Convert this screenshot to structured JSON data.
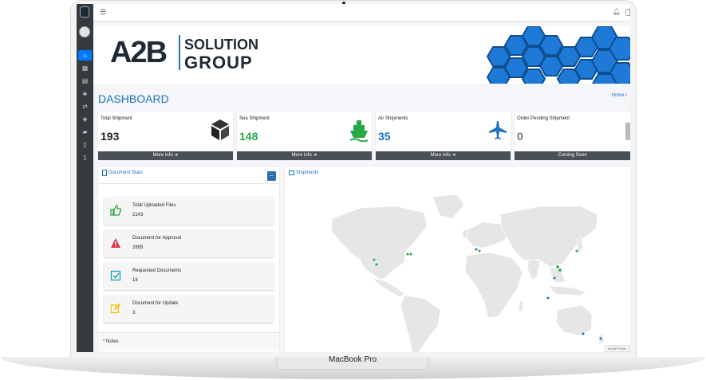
{
  "device": {
    "model_label": "MacBook Pro"
  },
  "navbar": {
    "menu_icon": "hamburger-icon",
    "bell_icon": "bell-icon"
  },
  "sidebar": {
    "items": [
      {
        "icon": "dashboard-icon",
        "active": true
      },
      {
        "icon": "building-icon",
        "active": false
      },
      {
        "icon": "document-icon",
        "active": false
      },
      {
        "icon": "layers-icon",
        "active": false
      },
      {
        "icon": "exchange-icon",
        "active": false
      },
      {
        "icon": "stack-icon",
        "active": false
      },
      {
        "icon": "truck-icon",
        "active": false
      },
      {
        "icon": "file-icon",
        "active": false
      },
      {
        "icon": "book-icon",
        "active": false
      }
    ]
  },
  "banner": {
    "logo_main": "A2B",
    "logo_line1": "SOLUTION",
    "logo_line2": "GROUP"
  },
  "header": {
    "title": "DASHBOARD",
    "breadcrumb": "Home /"
  },
  "cards": [
    {
      "title": "Total Shipment",
      "value": "193",
      "footer": "More info ➔",
      "icon": "box-icon",
      "color": "#222222"
    },
    {
      "title": "Sea Shipment",
      "value": "148",
      "footer": "More info ➔",
      "icon": "ship-icon",
      "color": "#28a745"
    },
    {
      "title": "Air Shipments",
      "value": "35",
      "footer": "More info ➔",
      "icon": "plane-icon",
      "color": "#1e73be"
    },
    {
      "title": "Order Pending Shipment",
      "value": "0",
      "footer": "Coming Soon",
      "icon": "pending-icon",
      "color": "#6c757d"
    }
  ],
  "documents": {
    "title": "Document Stats",
    "collapse_label": "−",
    "items": [
      {
        "label": "Total Uploaded Files",
        "value": "2143",
        "icon": "thumbs-up-icon",
        "color": "#28a745"
      },
      {
        "label": "Document for Approval",
        "value": "2895",
        "icon": "warning-icon",
        "color": "#dc3545"
      },
      {
        "label": "Requested Documents",
        "value": "18",
        "icon": "check-square-icon",
        "color": "#17a2b8"
      },
      {
        "label": "Document for Update",
        "value": "3",
        "icon": "edit-icon",
        "color": "#f0c419"
      }
    ],
    "notes_label": "* Notes"
  },
  "map": {
    "title": "Shipments",
    "recaptcha_label": "reCAPTCHA"
  },
  "colors": {
    "accent": "#1e73be",
    "sidebar": "#343a40",
    "active": "#007bff",
    "card_footer": "#495057",
    "hex_blue": "#1e7ad6"
  }
}
